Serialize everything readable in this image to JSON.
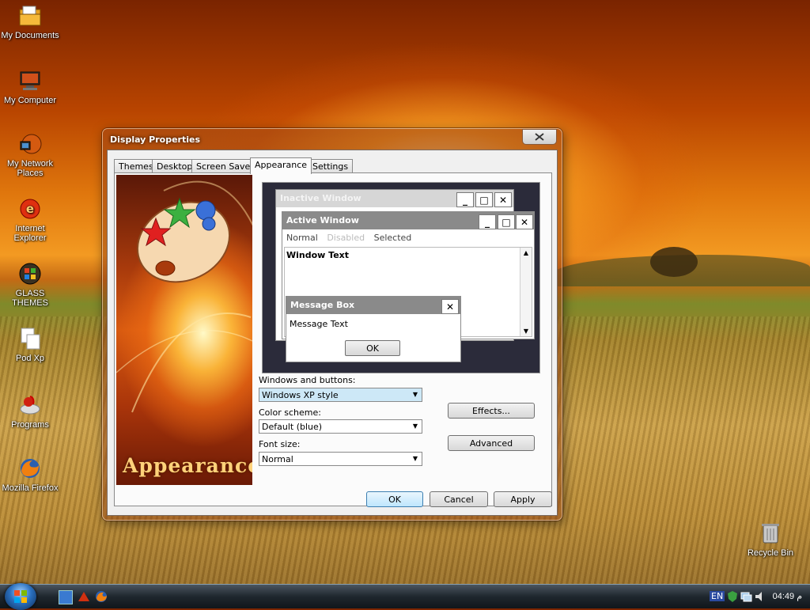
{
  "desktop": {
    "icons": [
      {
        "label": "My Documents",
        "icon": "folder-documents-icon"
      },
      {
        "label": "My Computer",
        "icon": "computer-icon"
      },
      {
        "label": "My Network Places",
        "icon": "network-places-icon"
      },
      {
        "label": "Internet Explorer",
        "icon": "internet-explorer-icon"
      },
      {
        "label": "GLASS THEMES",
        "icon": "windows-orb-icon"
      },
      {
        "label": "Pod Xp",
        "icon": "document-icon"
      },
      {
        "label": "Programs",
        "icon": "programs-icon"
      },
      {
        "label": "Mozilla Firefox",
        "icon": "firefox-icon"
      },
      {
        "label": "Recycle Bin",
        "icon": "recycle-bin-icon"
      }
    ]
  },
  "window": {
    "title": "Display Properties",
    "tabs": [
      "Themes",
      "Desktop",
      "Screen Saver",
      "Appearance",
      "Settings"
    ],
    "active_tab": "Appearance",
    "banner_title": "Appearance",
    "preview": {
      "inactive_title": "Inactive Window",
      "active_title": "Active Window",
      "menu_normal": "Normal",
      "menu_disabled": "Disabled",
      "menu_selected": "Selected",
      "window_text": "Window Text",
      "msgbox_title": "Message Box",
      "msgbox_text": "Message Text",
      "msgbox_ok": "OK"
    },
    "windows_buttons_label": "Windows and buttons:",
    "windows_buttons_value": "Windows XP style",
    "color_scheme_label": "Color scheme:",
    "color_scheme_value": "Default (blue)",
    "font_size_label": "Font size:",
    "font_size_value": "Normal",
    "effects_label": "Effects...",
    "advanced_label": "Advanced",
    "ok_label": "OK",
    "cancel_label": "Cancel",
    "apply_label": "Apply"
  },
  "taskbar": {
    "language": "EN",
    "clock": "04:49 م"
  },
  "colors": {
    "active_title": "#8a8a8a",
    "inactive_title": "#d6d6d6",
    "combo_highlight": "#cde8f7"
  }
}
